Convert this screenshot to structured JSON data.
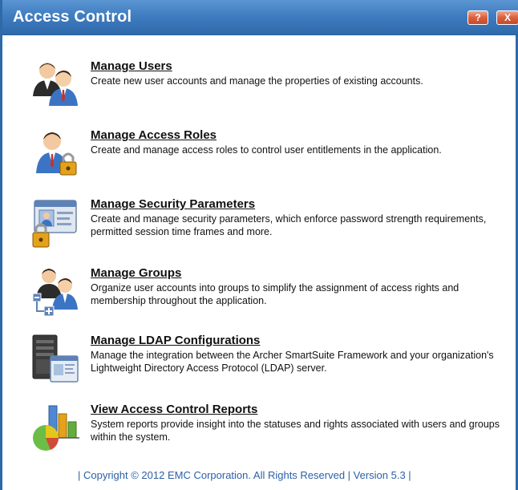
{
  "window": {
    "title": "Access Control",
    "help_label": "?",
    "close_label": "X"
  },
  "items": [
    {
      "title": "Manage Users",
      "desc": "Create new user accounts and manage the properties of existing accounts.",
      "icon": "users-icon"
    },
    {
      "title": "Manage Access Roles",
      "desc": "Create and manage access roles to control user entitlements in the application.",
      "icon": "user-lock-icon"
    },
    {
      "title": "Manage Security Parameters",
      "desc": "Create and manage security parameters, which enforce password strength requirements, permitted session time frames and more.",
      "icon": "security-card-lock-icon"
    },
    {
      "title": "Manage Groups",
      "desc": "Organize user accounts into groups to simplify the assignment of access rights and membership throughout the application.",
      "icon": "user-group-icon"
    },
    {
      "title": "Manage LDAP Configurations",
      "desc": "Manage the integration between the Archer SmartSuite Framework and your organization's Lightweight Directory Access Protocol (LDAP) server.",
      "icon": "server-document-icon"
    },
    {
      "title": "View Access Control Reports",
      "desc": "System reports provide insight into the statuses and rights associated with users and groups within the system.",
      "icon": "reports-chart-icon"
    }
  ],
  "footer": {
    "text": "|  Copyright © 2012 EMC Corporation.  All Rights Reserved  |  Version 5.3  |"
  },
  "colors": {
    "titlebar": "#3f7dc1",
    "close_button": "#d9603d",
    "footer_text": "#2b5fa8"
  }
}
